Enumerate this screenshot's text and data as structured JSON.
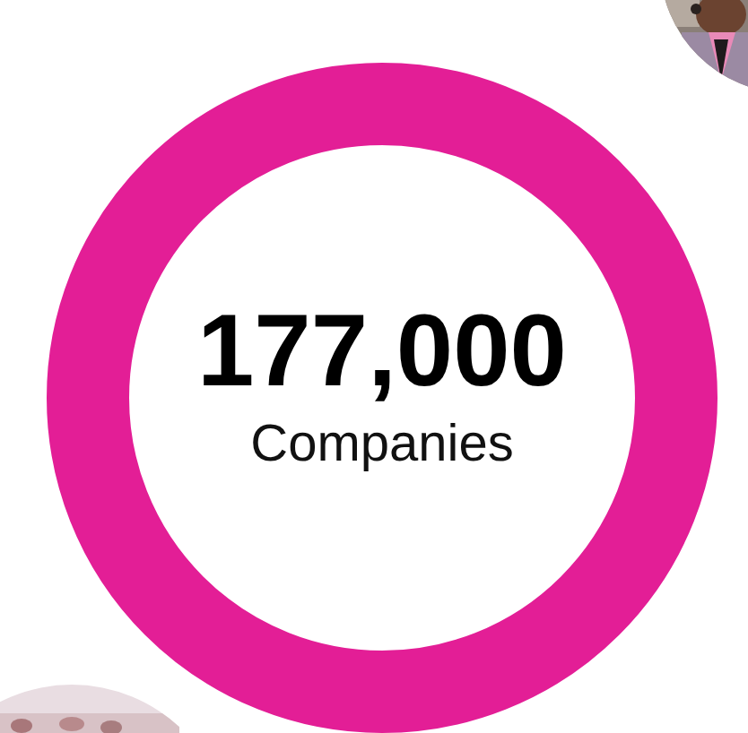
{
  "stat": {
    "value": "177,000",
    "label": "Companies"
  }
}
